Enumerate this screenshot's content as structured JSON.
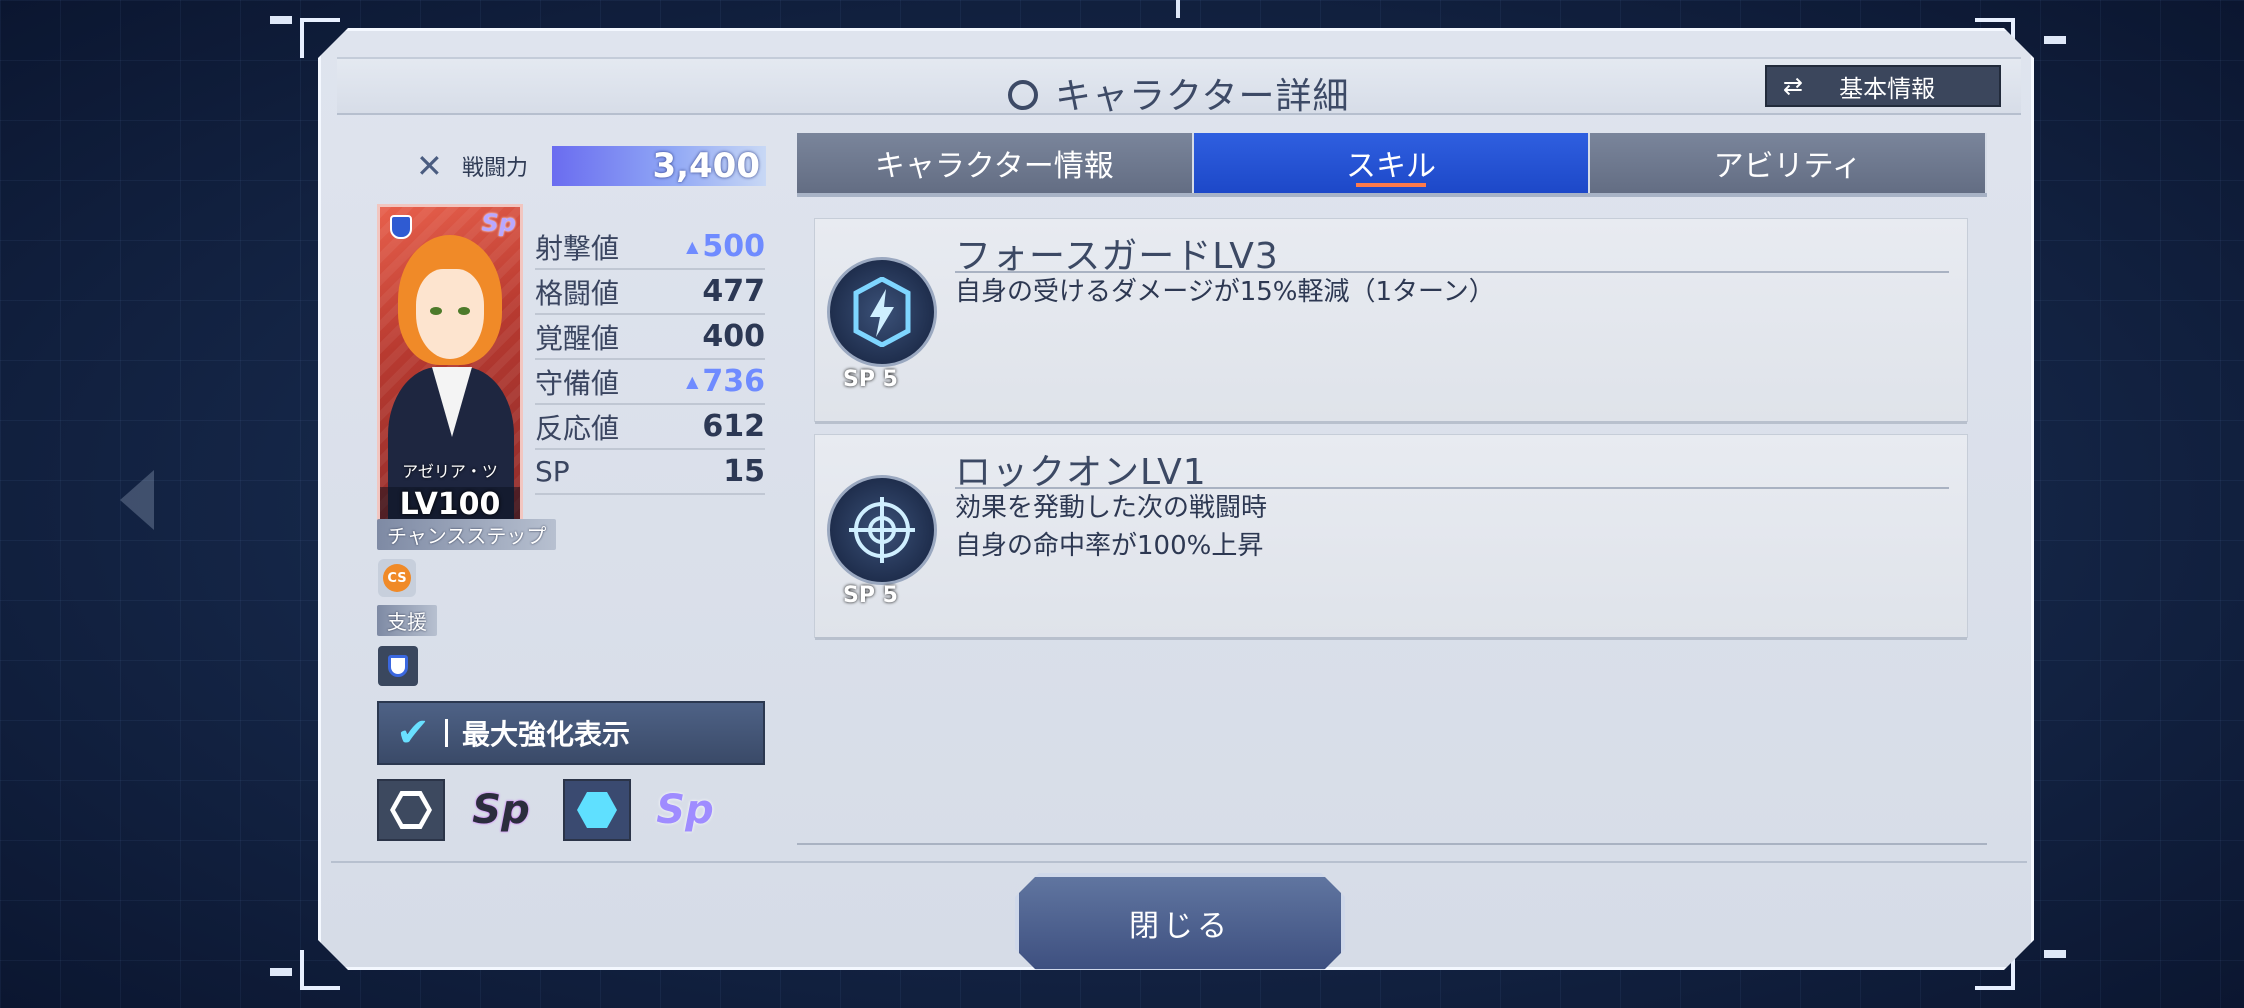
{
  "header": {
    "title": "キャラクター詳細",
    "basic_info_button": "基本情報"
  },
  "power": {
    "label": "戦闘力",
    "value": "3,400"
  },
  "card": {
    "name": "アゼリア・ツ",
    "level": "LV100",
    "badge": "Sp"
  },
  "stats": [
    {
      "label": "射撃値",
      "value": "500",
      "boosted": true
    },
    {
      "label": "格闘値",
      "value": "477",
      "boosted": false
    },
    {
      "label": "覚醒値",
      "value": "400",
      "boosted": false
    },
    {
      "label": "守備値",
      "value": "736",
      "boosted": true
    },
    {
      "label": "反応値",
      "value": "612",
      "boosted": false
    },
    {
      "label": "SP",
      "value": "15",
      "boosted": false
    }
  ],
  "chance_step": {
    "label": "チャンスステップ",
    "icon_text": "CS"
  },
  "support": {
    "label": "支援"
  },
  "max_enhance": {
    "label": "最大強化表示",
    "checked": true
  },
  "filters": [
    {
      "icon": "hexagon-outline-icon"
    },
    {
      "icon": "sp-dark-icon",
      "text": "Sp"
    },
    {
      "icon": "hexagon-filled-icon"
    },
    {
      "icon": "sp-light-icon",
      "text": "Sp"
    }
  ],
  "tabs": [
    {
      "label": "キャラクター情報",
      "active": false
    },
    {
      "label": "スキル",
      "active": true
    },
    {
      "label": "アビリティ",
      "active": false
    }
  ],
  "skills": [
    {
      "name": "フォースガードLV3",
      "description": "自身の受けるダメージが15%軽減（1ターン）",
      "sp": "SP 5",
      "icon": "shield-lightning-icon"
    },
    {
      "name": "ロックオンLV1",
      "description": "効果を発動した次の戦闘時\n自身の命中率が100%上昇",
      "sp": "SP 5",
      "icon": "crosshair-icon"
    }
  ],
  "close_button": "閉じる",
  "colors": {
    "active_tab": "#1d48c8",
    "tab": "#636d83",
    "boost": "#6f8bff",
    "accent": "#ff7a4a"
  }
}
